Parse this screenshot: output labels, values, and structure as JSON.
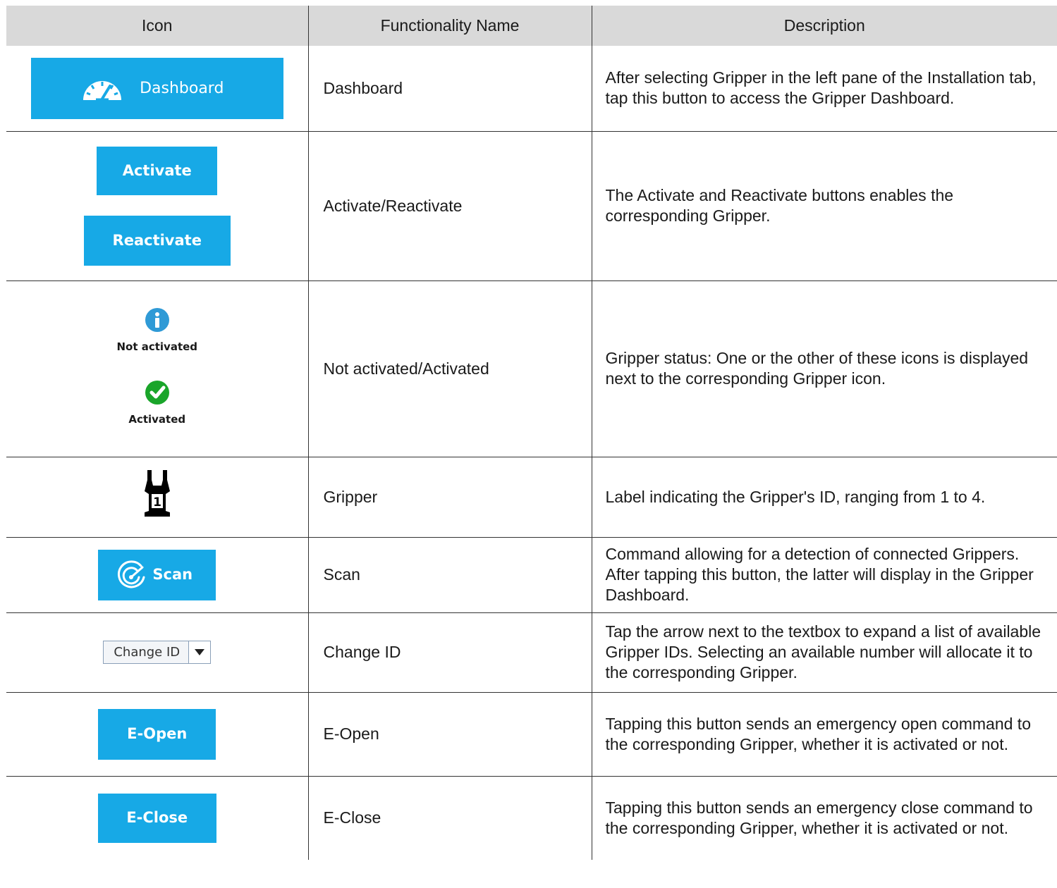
{
  "table": {
    "headers": {
      "icon": "Icon",
      "name": "Functionality Name",
      "description": "Description"
    },
    "rows": [
      {
        "icon": "dashboard-button",
        "button_label": "Dashboard",
        "name": "Dashboard",
        "description": "After selecting Gripper in the left pane of the Installation tab, tap this button to access the Gripper Dashboard."
      },
      {
        "icon": "activate-reactivate-buttons",
        "button_label": "Activate",
        "button_label_2": "Reactivate",
        "name": "Activate/Reactivate",
        "description": "The Activate and Reactivate buttons enables the corresponding Gripper."
      },
      {
        "icon": "status-icons",
        "status_label": "Not activated",
        "status_label_2": "Activated",
        "name": "Not activated/Activated",
        "description": "Gripper status: One or the other of these icons is displayed next to the corresponding Gripper icon."
      },
      {
        "icon": "gripper-icon",
        "gripper_id": "1",
        "name": "Gripper",
        "description": "Label indicating the Gripper's ID, ranging from 1 to 4."
      },
      {
        "icon": "scan-button",
        "button_label": "Scan",
        "name": "Scan",
        "description": "Command allowing for a detection of connected Grippers. After tapping this button, the latter will display in the Gripper Dashboard."
      },
      {
        "icon": "change-id-dropdown",
        "dropdown_value": "Change ID",
        "name": "Change ID",
        "description": "Tap the arrow next to the textbox to expand a list of available Gripper IDs. Selecting an available number will allocate it to the corresponding Gripper."
      },
      {
        "icon": "e-open-button",
        "button_label": "E-Open",
        "name": "E-Open",
        "description": "Tapping this button sends an emergency open command to the corresponding Gripper, whether it is activated or not."
      },
      {
        "icon": "e-close-button",
        "button_label": "E-Close",
        "name": "E-Close",
        "description": "Tapping this button sends an emergency close command to the corresponding Gripper, whether it is activated or not."
      }
    ]
  },
  "colors": {
    "button_blue": "#17a9e6",
    "header_gray": "#d9d9d9",
    "info_blue": "#2f9ad6",
    "success_green": "#1aa52a"
  }
}
